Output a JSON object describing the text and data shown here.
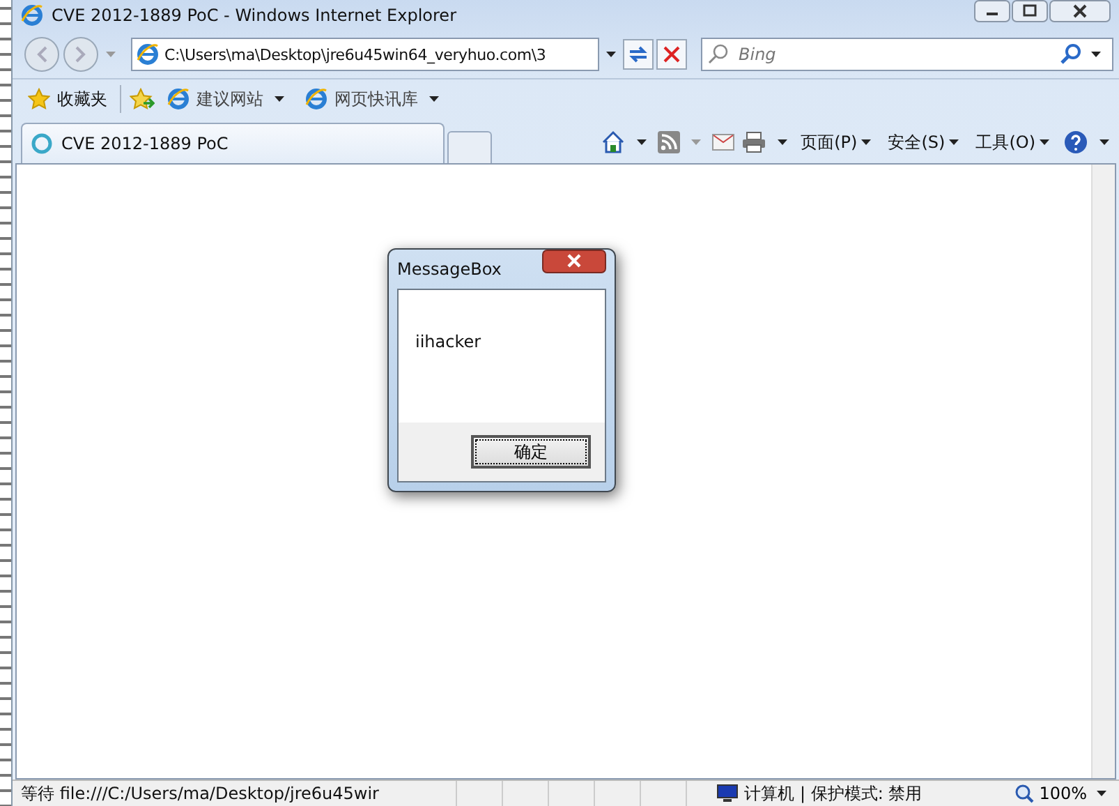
{
  "window": {
    "title": "CVE 2012-1889 PoC - Windows Internet Explorer"
  },
  "address_bar": {
    "value": "C:\\Users\\ma\\Desktop\\jre6u45win64_veryhuo.com\\3"
  },
  "search": {
    "placeholder": "Bing"
  },
  "favorites_bar": {
    "label": "收藏夹",
    "items": [
      "建议网站",
      "网页快讯库"
    ]
  },
  "tabs": [
    {
      "label": "CVE 2012-1889 PoC",
      "selected": true
    }
  ],
  "command_bar": {
    "menus": [
      "页面(P)",
      "安全(S)",
      "工具(O)"
    ]
  },
  "dialog": {
    "title": "MessageBox",
    "message": "iihacker",
    "button": "确定"
  },
  "status_bar": {
    "text": "等待 file:///C:/Users/ma/Desktop/jre6u45wir",
    "zone": "计算机 | 保护模式: 禁用",
    "zoom": "100%"
  }
}
